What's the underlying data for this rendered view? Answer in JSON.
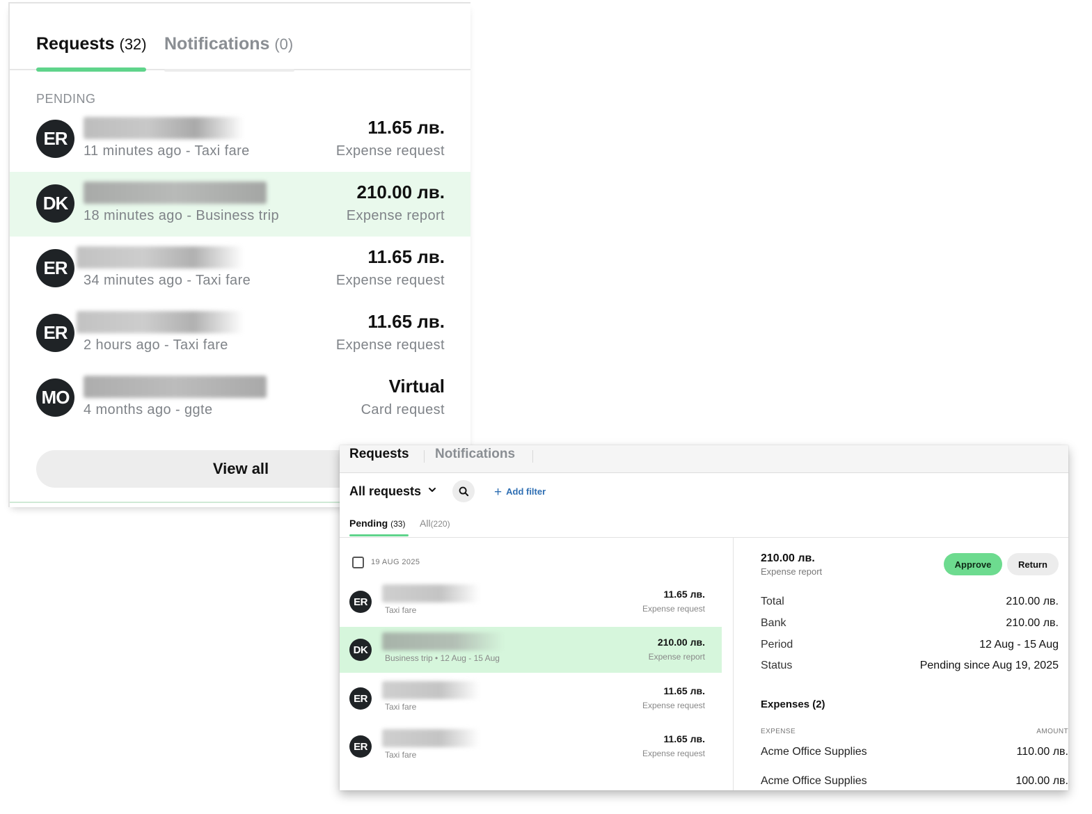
{
  "widget": {
    "tabs": [
      {
        "label": "Requests",
        "count": "(32)"
      },
      {
        "label": "Notifications",
        "count": "(0)"
      }
    ],
    "section_label": "PENDING",
    "rows": [
      {
        "initials": "ER",
        "subtitle": "11 minutes ago - Taxi fare",
        "amount": "11.65 лв.",
        "type": "Expense request"
      },
      {
        "initials": "DK",
        "subtitle": "18 minutes ago - Business trip",
        "amount": "210.00 лв.",
        "type": "Expense report"
      },
      {
        "initials": "ER",
        "subtitle": "34 minutes ago - Taxi fare",
        "amount": "11.65 лв.",
        "type": "Expense request"
      },
      {
        "initials": "ER",
        "subtitle": "2 hours ago - Taxi fare",
        "amount": "11.65 лв.",
        "type": "Expense request"
      },
      {
        "initials": "MO",
        "subtitle": "4 months ago - ggte",
        "amount": "Virtual",
        "type": "Card request"
      }
    ],
    "view_all_label": "View all"
  },
  "app": {
    "tabs": [
      {
        "label": "Requests"
      },
      {
        "label": "Notifications"
      }
    ],
    "filter_label": "All requests",
    "add_filter_label": "Add filter",
    "subtabs": [
      {
        "label": "Pending",
        "count": "(33)"
      },
      {
        "label": "All",
        "count": "(220)"
      }
    ],
    "date_group": "19 AUG 2025",
    "rows": [
      {
        "initials": "ER",
        "subtitle": "Taxi fare",
        "amount": "11.65 лв.",
        "type": "Expense request"
      },
      {
        "initials": "DK",
        "subtitle": "Business trip • 12 Aug - 15 Aug",
        "amount": "210.00 лв.",
        "type": "Expense report"
      },
      {
        "initials": "ER",
        "subtitle": "Taxi fare",
        "amount": "11.65 лв.",
        "type": "Expense request"
      },
      {
        "initials": "ER",
        "subtitle": "Taxi fare",
        "amount": "11.65 лв.",
        "type": "Expense request"
      }
    ],
    "detail": {
      "amount": "210.00 лв.",
      "type": "Expense report",
      "approve_label": "Approve",
      "return_label": "Return",
      "fields": [
        {
          "label": "Total",
          "value": "210.00 лв."
        },
        {
          "label": "Bank",
          "value": "210.00 лв."
        },
        {
          "label": "Period",
          "value": "12 Aug - 15 Aug"
        },
        {
          "label": "Status",
          "value": "Pending since Aug 19, 2025"
        }
      ],
      "expenses_heading": "Expenses (2)",
      "col_expense": "EXPENSE",
      "col_amount": "AMOUNT",
      "expenses": [
        {
          "name": "Acme Office Supplies",
          "amount": "110.00 лв."
        },
        {
          "name": "Acme Office Supplies",
          "amount": "100.00 лв."
        }
      ]
    }
  },
  "colors": {
    "accent_green": "#5fd48b",
    "highlight_row": "#e9f9ec",
    "avatar_bg": "#1f2326",
    "link_blue": "#2f6fb3"
  },
  "icons": [
    "chevron-down-icon",
    "search-icon",
    "plus-icon"
  ]
}
